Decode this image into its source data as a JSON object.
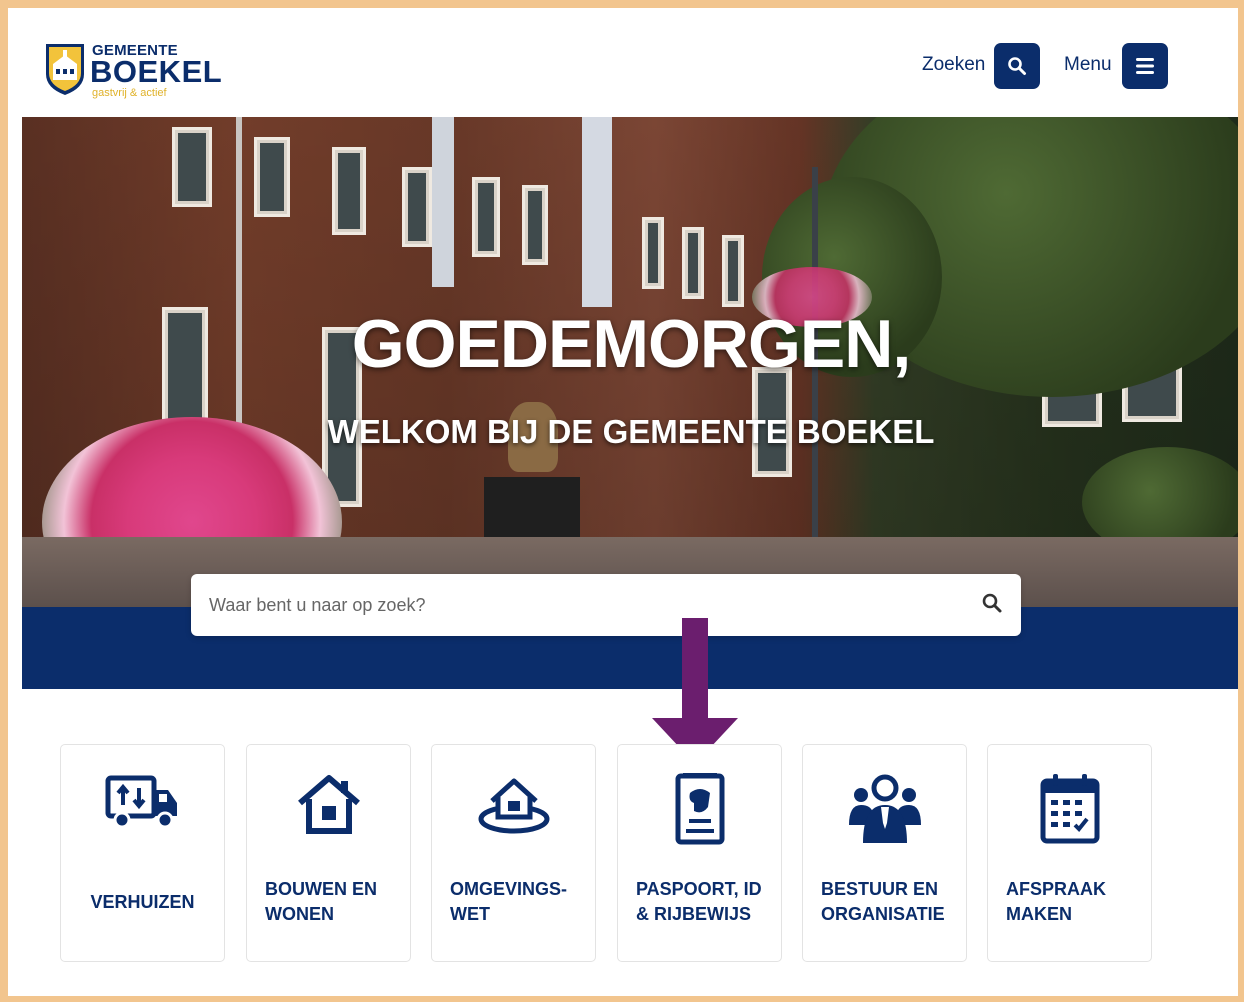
{
  "header": {
    "logo": {
      "top": "GEMEENTE",
      "main": "BOEKEL",
      "sub": "gastvrij & actief"
    },
    "search_label": "Zoeken",
    "menu_label": "Menu"
  },
  "hero": {
    "title": "GOEDEMORGEN,",
    "subtitle": "WELKOM BIJ DE GEMEENTE BOEKEL"
  },
  "search": {
    "placeholder": "Waar bent u naar op zoek?"
  },
  "colors": {
    "brand": "#0b2d6b",
    "accent_arrow": "#6b1e6e",
    "frame": "#f2c58e",
    "logo_sub": "#e0b22a"
  },
  "tiles": [
    {
      "label": "VERHUIZEN",
      "icon": "moving-truck-icon"
    },
    {
      "label": "BOUWEN EN\nWONEN",
      "icon": "house-icon"
    },
    {
      "label": "OMGEVINGS-\nWET",
      "icon": "house-on-land-icon"
    },
    {
      "label": "PASPOORT, ID\n& RIJBEWIJS",
      "icon": "passport-icon"
    },
    {
      "label": "BESTUUR EN\nORGANISATIE",
      "icon": "people-group-icon"
    },
    {
      "label": "AFSPRAAK\nMAKEN",
      "icon": "calendar-icon"
    }
  ]
}
